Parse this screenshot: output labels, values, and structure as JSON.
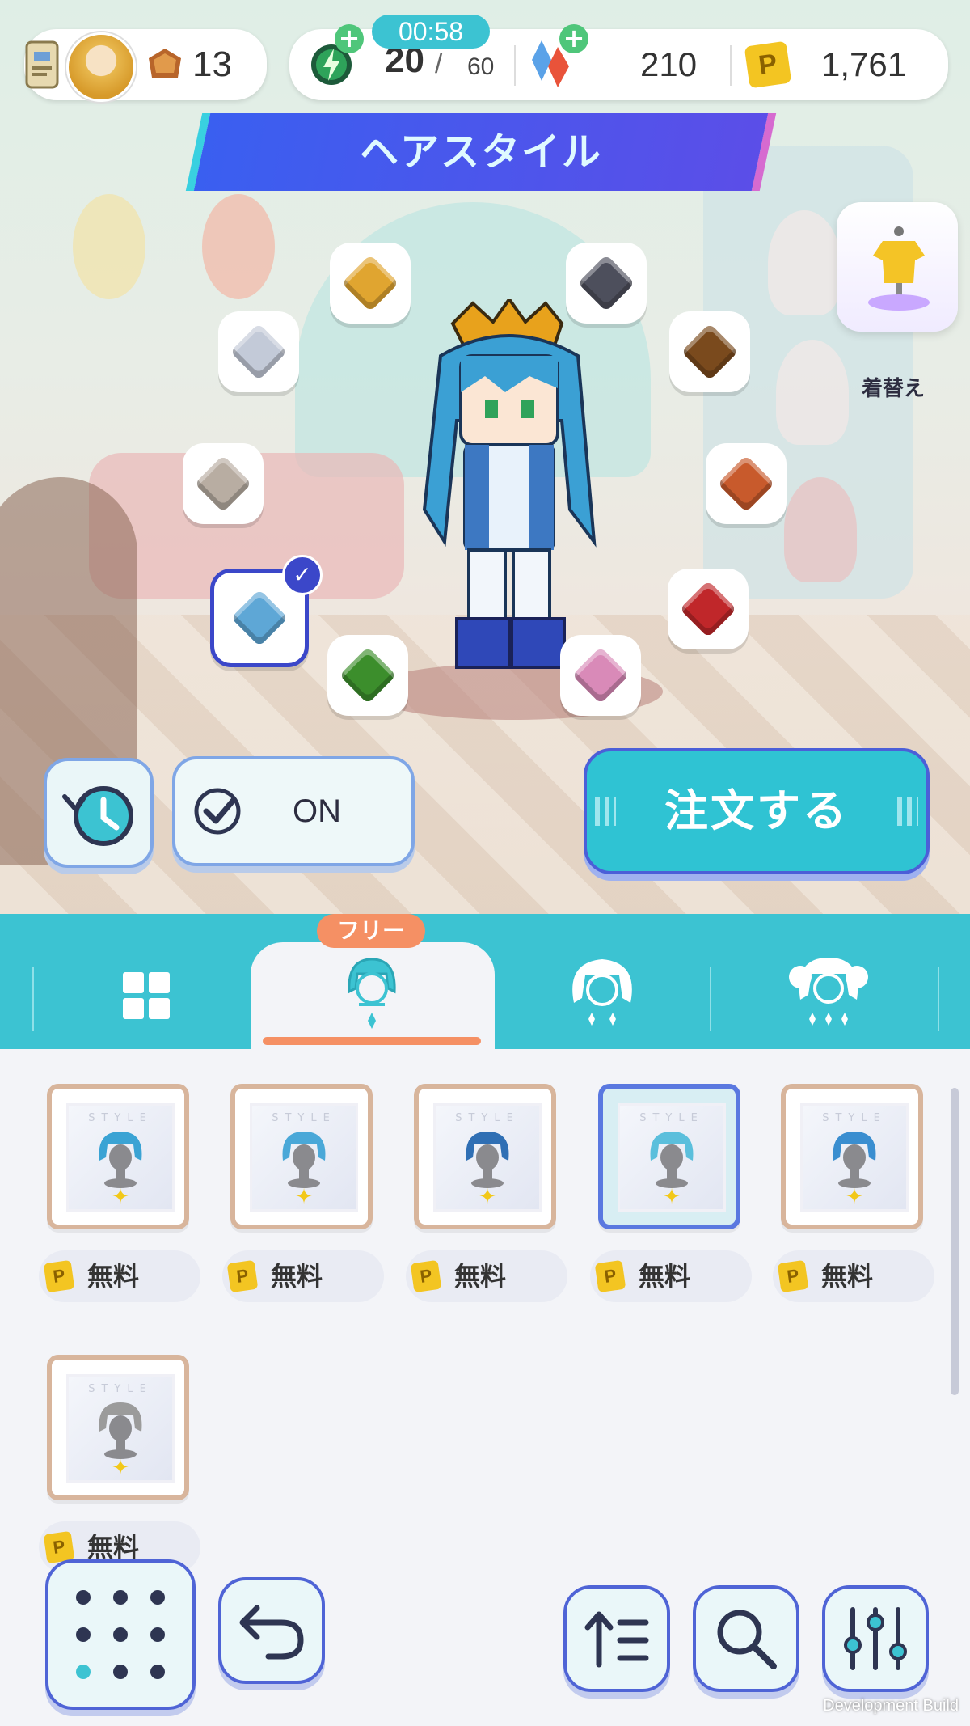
{
  "header": {
    "rank_value": "13",
    "timer": "00:58",
    "stamina_current": "20",
    "stamina_max": "60",
    "gems": "210",
    "coins": "1,761",
    "plus_symbol": "+"
  },
  "banner": {
    "title": "ヘアスタイル"
  },
  "side_button": {
    "label": "着替え"
  },
  "hair_colors": [
    {
      "name": "gold",
      "color": "#e0a530"
    },
    {
      "name": "dark-gray",
      "color": "#4d4f5c"
    },
    {
      "name": "silver",
      "color": "#c3cad8"
    },
    {
      "name": "brown",
      "color": "#7a4a1d"
    },
    {
      "name": "beige-gray",
      "color": "#b8ada2"
    },
    {
      "name": "orange-red",
      "color": "#c85a2c"
    },
    {
      "name": "sky-blue",
      "color": "#5ea7d6",
      "selected": true
    },
    {
      "name": "red",
      "color": "#c0272a"
    },
    {
      "name": "green",
      "color": "#3c8e2c"
    },
    {
      "name": "pink",
      "color": "#d98ab8"
    }
  ],
  "controls": {
    "toggle_label": "ON",
    "order_label": "注文する"
  },
  "tabs": {
    "free_badge": "フリー",
    "items": [
      {
        "name": "all",
        "active": false
      },
      {
        "name": "free-hair",
        "active": true
      },
      {
        "name": "hair-2",
        "active": false
      },
      {
        "name": "hair-3",
        "active": false
      }
    ]
  },
  "grid": {
    "style_text": "STYLE",
    "items": [
      {
        "price": "無料",
        "coin": "P",
        "hair_color": "#3aa3d4",
        "selected": false
      },
      {
        "price": "無料",
        "coin": "P",
        "hair_color": "#4aa8d8",
        "selected": false
      },
      {
        "price": "無料",
        "coin": "P",
        "hair_color": "#2f6fb4",
        "selected": false
      },
      {
        "price": "無料",
        "coin": "P",
        "hair_color": "#5bbfdc",
        "selected": true
      },
      {
        "price": "無料",
        "coin": "P",
        "hair_color": "#3a8ed0",
        "selected": false
      },
      {
        "price": "無料",
        "coin": "P",
        "hair_color": "#9b9b9b",
        "selected": false
      }
    ]
  },
  "footer": {
    "dev_text": "Development Build"
  },
  "colors": {
    "accent_teal": "#3cc3d2",
    "accent_blue": "#4f64d6",
    "badge_orange": "#f59064"
  },
  "icons": [
    "profile-card-icon",
    "avatar-icon",
    "rank-icon",
    "stamina-icon",
    "crystal-icon",
    "coin-icon",
    "history-icon",
    "check-icon",
    "grid-icon",
    "menu-dots-icon",
    "back-arrow-icon",
    "sort-icon",
    "search-icon",
    "filter-icon"
  ]
}
